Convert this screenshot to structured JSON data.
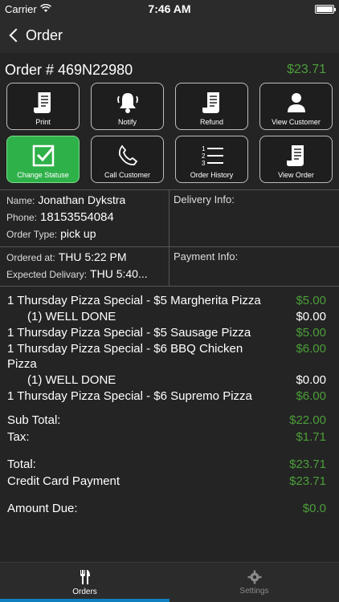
{
  "status_bar": {
    "carrier": "Carrier",
    "time": "7:46 AM",
    "battery_level": 1.0
  },
  "nav": {
    "back_label": "Order"
  },
  "order": {
    "number": "Order # 469N22980",
    "total": "$23.71"
  },
  "actions": [
    {
      "label": "Print",
      "icon": "receipt-icon"
    },
    {
      "label": "Notify",
      "icon": "bell-icon"
    },
    {
      "label": "Refund",
      "icon": "receipt-icon"
    },
    {
      "label": "View Customer",
      "icon": "person-icon"
    },
    {
      "label": "Change Statuse",
      "icon": "checkbox-icon"
    },
    {
      "label": "Call Customer",
      "icon": "phone-icon"
    },
    {
      "label": "Order History",
      "icon": "list-icon"
    },
    {
      "label": "View Order",
      "icon": "receipt-icon"
    }
  ],
  "customer": {
    "name_label": "Name:",
    "name": "Jonathan Dykstra",
    "phone_label": "Phone:",
    "phone": "18153554084",
    "type_label": "Order Type:",
    "type": "pick up",
    "delivery_info_label": "Delivery Info:"
  },
  "timing": {
    "ordered_label": "Ordered at:",
    "ordered": "THU 5:22 PM",
    "expected_label": "Expected Delivary:",
    "expected": "THU 5:40...",
    "payment_info_label": "Payment Info:"
  },
  "items": [
    {
      "name": "1 Thursday Pizza Special - $5 Margherita Pizza",
      "price": "$5.00"
    },
    {
      "name": "(1) WELL DONE",
      "price": "$0.00",
      "modifier": true
    },
    {
      "name": "1 Thursday Pizza Special - $5 Sausage Pizza",
      "price": "$5.00"
    },
    {
      "name": "1 Thursday Pizza Special - $6 BBQ Chicken Pizza",
      "price": "$6.00"
    },
    {
      "name": "(1) WELL DONE",
      "price": "$0.00",
      "modifier": true
    },
    {
      "name": "1 Thursday Pizza Special - $6 Supremo Pizza",
      "price": "$6.00"
    }
  ],
  "totals": {
    "subtotal_label": "Sub Total:",
    "subtotal": "$22.00",
    "tax_label": "Tax:",
    "tax": "$1.71",
    "total_label": "Total:",
    "total": "$23.71",
    "payment_label": "Credit Card Payment",
    "payment": "$23.71",
    "due_label": "Amount Due:",
    "due": "$0.0"
  },
  "tabs": [
    {
      "label": "Orders",
      "icon": "utensils-icon",
      "active": true
    },
    {
      "label": "Settings",
      "icon": "gear-icon",
      "active": false
    }
  ],
  "colors": {
    "accent_green": "#4c9e3a",
    "button_green": "#2fb14a",
    "tab_indicator": "#0f7fbf",
    "background": "#242424"
  }
}
